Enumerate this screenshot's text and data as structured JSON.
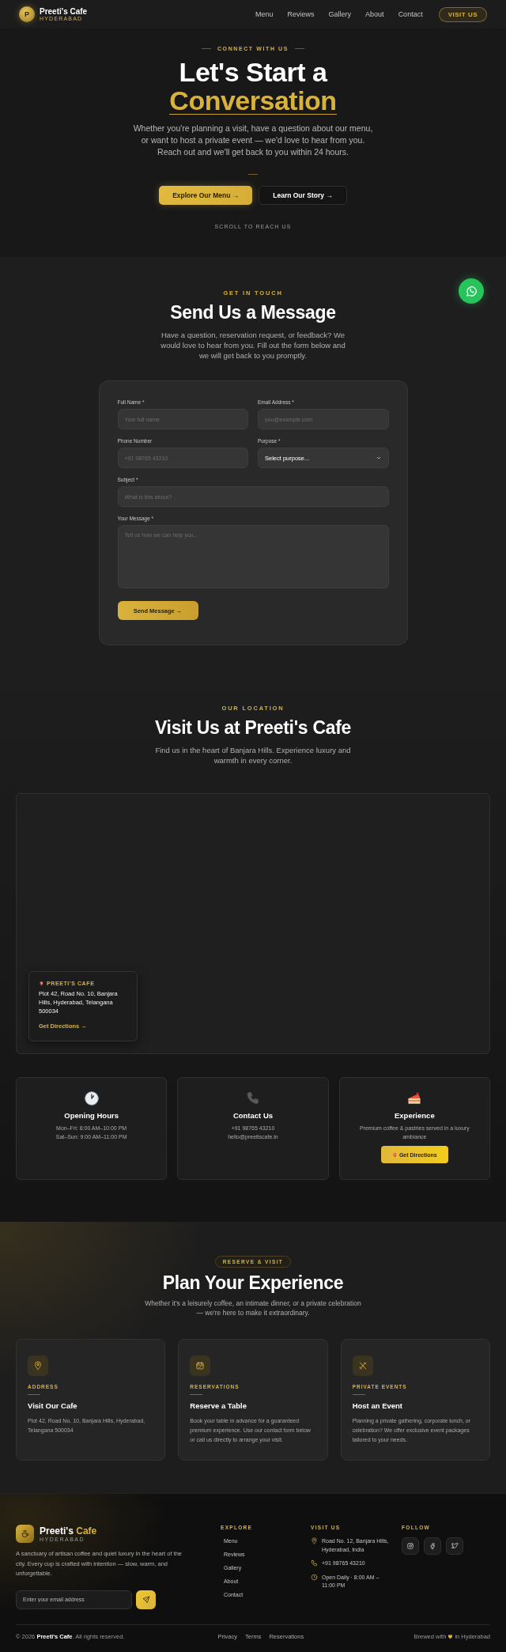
{
  "header": {
    "logo_letter": "P",
    "brand": "Preeti's Cafe",
    "tagline": "HYDERABAD",
    "nav": [
      {
        "label": "Menu"
      },
      {
        "label": "Reviews"
      },
      {
        "label": "Gallery"
      },
      {
        "label": "About"
      },
      {
        "label": "Contact"
      }
    ],
    "cta": "VISIT US"
  },
  "hero": {
    "eyebrow": "CONNECT WITH US",
    "title_line1": "Let's Start a",
    "title_line2": "Conversation",
    "description": "Whether you're planning a visit, have a question about our menu, or want to host a private event — we'd love to hear from you. Reach out and we'll get back to you within 24 hours.",
    "buttons": [
      {
        "label": "Explore Our Menu →",
        "kind": "primary"
      },
      {
        "label": "Learn Our Story →",
        "kind": "secondary"
      }
    ],
    "scroll_hint": "SCROLL TO REACH US"
  },
  "contact": {
    "eyebrow": "GET IN TOUCH",
    "title": "Send Us a Message",
    "description": "Have a question, reservation request, or feedback? We would love to hear from you. Fill out the form below and we will get back to you promptly.",
    "form": {
      "rows": [
        [
          {
            "kind": "input",
            "label": "Full Name *",
            "placeholder": "Your full name"
          },
          {
            "kind": "input",
            "label": "Email Address *",
            "placeholder": "you@example.com"
          }
        ],
        [
          {
            "kind": "input",
            "label": "Phone Number",
            "placeholder": "+91 98765 43210"
          },
          {
            "kind": "select",
            "label": "Purpose *",
            "value": "Select purpose..."
          }
        ],
        [
          {
            "kind": "input",
            "label": "Subject *",
            "placeholder": "What is this about?"
          }
        ],
        [
          {
            "kind": "textarea",
            "label": "Your Message *",
            "placeholder": "Tell us how we can help you..."
          }
        ]
      ],
      "submit": "Send Message →"
    }
  },
  "location": {
    "eyebrow": "OUR LOCATION",
    "title": "Visit Us at Preeti's Cafe",
    "description": "Find us in the heart of Banjara Hills. Experience luxury and warmth in every corner.",
    "map_card": {
      "name": "PREETI'S CAFE",
      "address": "Plot 42, Road No. 10, Banjara Hills, Hyderabad, Telangana 500034",
      "link": "Get Directions →"
    },
    "cards": [
      {
        "title": "Opening Hours",
        "lines": [
          "Mon–Fri: 8:00 AM–10:00 PM",
          "Sat–Sun: 9:00 AM–11:00 PM"
        ]
      },
      {
        "title": "Contact Us",
        "lines": [
          "+91 98765 43210",
          "hello@preetiscafe.in"
        ]
      },
      {
        "title": "Experience",
        "lines": [
          "Premium coffee & pastries served in a luxury ambiance"
        ],
        "button": "Get Directions"
      }
    ]
  },
  "plan": {
    "badge": "RESERVE & VISIT",
    "title": "Plan Your Experience",
    "description": "Whether it's a leisurely coffee, an intimate dinner, or a private celebration — we're here to make it extraordinary.",
    "cards": [
      {
        "label": "ADDRESS",
        "title": "Visit Our Cafe",
        "text": "Plot 42, Road No. 10, Banjara Hills, Hyderabad, Telangana 500034"
      },
      {
        "label": "RESERVATIONS",
        "title": "Reserve a Table",
        "text": "Book your table in advance for a guaranteed premium experience. Use our contact form below or call us directly to arrange your visit."
      },
      {
        "label": "PRIVATE EVENTS",
        "title": "Host an Event",
        "text": "Planning a private gathering, corporate lunch, or celebration? We offer exclusive event packages tailored to your needs."
      }
    ]
  },
  "footer": {
    "brand_name": "Preeti's",
    "brand_accent": "Cafe",
    "tagline": "HYDERABAD",
    "description": "A sanctuary of artisan coffee and quiet luxury in the heart of the city. Every cup is crafted with intention — slow, warm, and unforgettable.",
    "email_placeholder": "Enter your email address",
    "explore": {
      "heading": "EXPLORE",
      "links": [
        "Menu",
        "Reviews",
        "Gallery",
        "About",
        "Contact"
      ]
    },
    "visit": {
      "heading": "VISIT US",
      "items": [
        "Road No. 12, Banjara Hills, Hyderabad, India",
        "+91 98765 43210",
        "Open Daily · 8:00 AM – 11:00 PM"
      ]
    },
    "follow": {
      "heading": "FOLLOW"
    },
    "copyright": "© 2026 **Preeti's Cafe**. All rights reserved.",
    "links": [
      "Privacy",
      "Terms",
      "Reservations"
    ],
    "credit_before": "Brewed with",
    "credit_after": "in Hyderabad"
  }
}
